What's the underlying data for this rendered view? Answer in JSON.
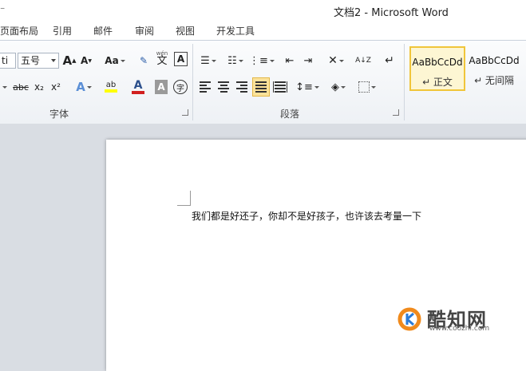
{
  "window": {
    "title": "文档2  -  Microsoft Word",
    "left_fragment": "⁻"
  },
  "tabs": [
    {
      "label": "页面布局"
    },
    {
      "label": "引用"
    },
    {
      "label": "邮件"
    },
    {
      "label": "审阅"
    },
    {
      "label": "视图"
    },
    {
      "label": "开发工具"
    }
  ],
  "font_group": {
    "font_name_value": "ti",
    "font_size_value": "五号",
    "grow_label": "A",
    "shrink_label": "A",
    "case_label": "Aa",
    "phonetic_label": "wén",
    "phonetic_char": "文",
    "border_char_label": "A",
    "strike_label": "abc",
    "sub_label": "x₂",
    "sup_label": "x²",
    "effects_label": "A",
    "highlight_label": "ab",
    "color_label": "A",
    "shading_label": "A",
    "enclose_label": "字",
    "group_label": "字体",
    "highlight_color": "#ffff00",
    "font_color": "#d11f1f"
  },
  "paragraph_group": {
    "sort_label": "A↓Z",
    "pilcrow_label": "↵",
    "group_label": "段落"
  },
  "styles": [
    {
      "sample": "AaBbCcDd",
      "name": "↵ 正文",
      "selected": true
    },
    {
      "sample": "AaBbCcDd",
      "name": "↵ 无间隔",
      "selected": false
    }
  ],
  "document": {
    "text": "我们都是好还子，你却不是好孩子，也许该去考量一下"
  },
  "watermark": {
    "brand": "酷知网",
    "url": "www.coozhi.com"
  }
}
